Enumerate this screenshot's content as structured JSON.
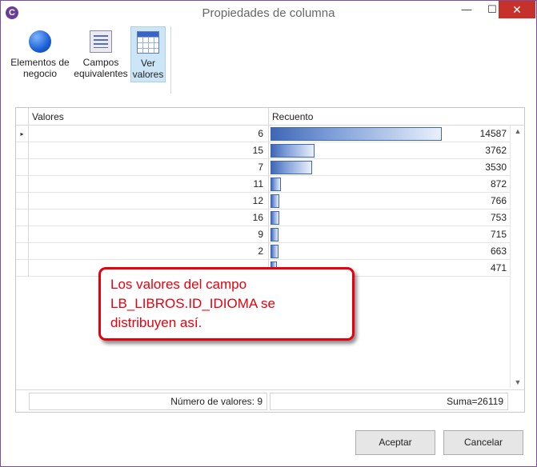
{
  "window": {
    "title": "Propiedades de columna",
    "app_icon": "C",
    "controls": {
      "minimize": "—",
      "maximize": "☐",
      "close": "✕"
    }
  },
  "toolbar": {
    "items": [
      {
        "label_line1": "Elementos de",
        "label_line2": "negocio",
        "icon": "globe-icon"
      },
      {
        "label_line1": "Campos",
        "label_line2": "equivalentes",
        "icon": "document-list-icon"
      },
      {
        "label_line1": "Ver",
        "label_line2": "valores",
        "icon": "grid-table-icon",
        "selected": true
      }
    ]
  },
  "grid": {
    "columns": [
      "Valores",
      "Recuento"
    ],
    "current_row_marker": "▸",
    "rows": [
      {
        "value": "6",
        "count": "14587",
        "count_num": 14587
      },
      {
        "value": "15",
        "count": "3762",
        "count_num": 3762
      },
      {
        "value": "7",
        "count": "3530",
        "count_num": 3530
      },
      {
        "value": "11",
        "count": "872",
        "count_num": 872
      },
      {
        "value": "12",
        "count": "766",
        "count_num": 766
      },
      {
        "value": "16",
        "count": "753",
        "count_num": 753
      },
      {
        "value": "9",
        "count": "715",
        "count_num": 715
      },
      {
        "value": "2",
        "count": "663",
        "count_num": 663
      },
      {
        "value": "",
        "count": "471",
        "count_num": 471
      }
    ],
    "max_count": 14587,
    "footer": {
      "num_values": "Número de valores: 9",
      "sum": "Suma=26119"
    },
    "scroll": {
      "up": "▲",
      "down": "▼"
    }
  },
  "callout": {
    "line1": "Los valores del campo",
    "line2": "LB_LIBROS.ID_IDIOMA se",
    "line3": "distribuyen así."
  },
  "buttons": {
    "accept": "Aceptar",
    "cancel": "Cancelar"
  },
  "colors": {
    "close_button": "#c7312b",
    "callout_border": "#e8000e",
    "bar": "#3f67b5",
    "selected_tool": "#cde6f7"
  }
}
